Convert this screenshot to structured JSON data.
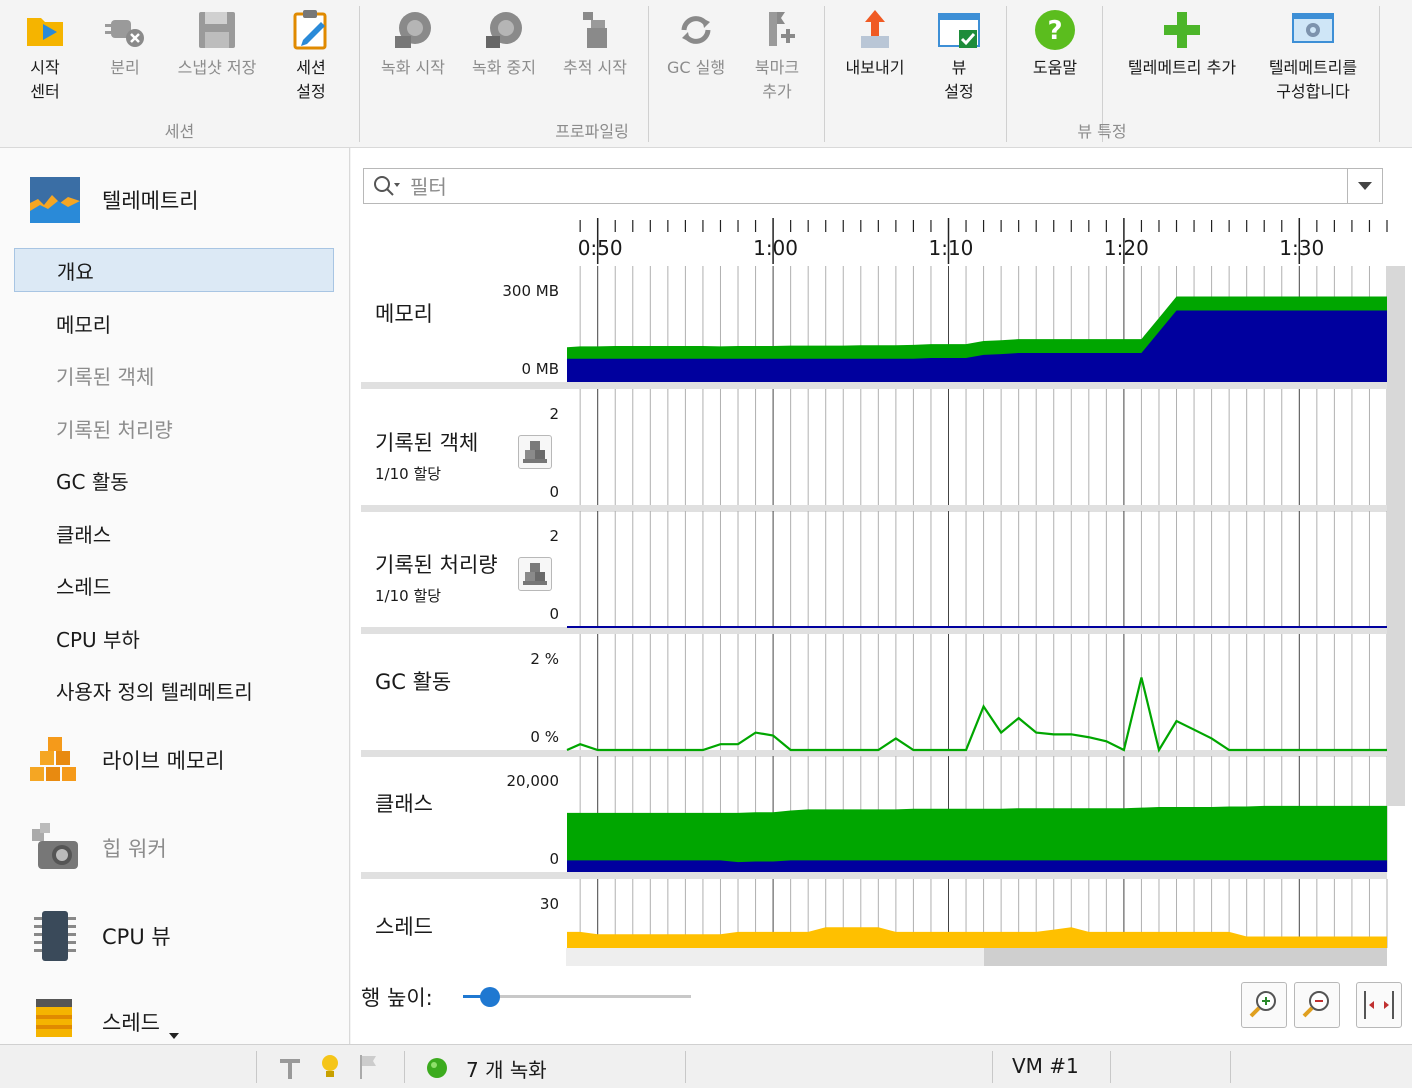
{
  "toolbar": {
    "buttons": [
      {
        "label": "시작\n센터",
        "icon": "start-center-icon",
        "enabled": true
      },
      {
        "label": "분리",
        "icon": "detach-icon",
        "enabled": false
      },
      {
        "label": "스냅샷 저장",
        "icon": "save-snapshot-icon",
        "enabled": false
      },
      {
        "label": "세션\n설정",
        "icon": "session-settings-icon",
        "enabled": true
      },
      {
        "label": "녹화 시작",
        "icon": "start-recording-icon",
        "enabled": false
      },
      {
        "label": "녹화 중지",
        "icon": "stop-recording-icon",
        "enabled": false
      },
      {
        "label": "추적 시작",
        "icon": "start-tracking-icon",
        "enabled": false
      },
      {
        "label": "GC 실행",
        "icon": "run-gc-icon",
        "enabled": false
      },
      {
        "label": "북마크\n추가",
        "icon": "add-bookmark-icon",
        "enabled": false
      },
      {
        "label": "내보내기",
        "icon": "export-icon",
        "enabled": true
      },
      {
        "label": "뷰\n설정",
        "icon": "view-settings-icon",
        "enabled": true
      },
      {
        "label": "도움말",
        "icon": "help-icon",
        "enabled": true
      },
      {
        "label": "텔레메트리 추가",
        "icon": "add-telemetry-icon",
        "enabled": true
      },
      {
        "label": "텔레메트리를\n구성합니다",
        "icon": "configure-telemetry-icon",
        "enabled": true
      }
    ],
    "groups": [
      "세션",
      "프로파일링",
      "뷰 특정"
    ]
  },
  "sidebar": {
    "telemetry_header": "텔레메트리",
    "items": [
      {
        "label": "개요",
        "selected": true,
        "enabled": true
      },
      {
        "label": "메모리",
        "selected": false,
        "enabled": true
      },
      {
        "label": "기록된 객체",
        "selected": false,
        "enabled": false
      },
      {
        "label": "기록된 처리량",
        "selected": false,
        "enabled": false
      },
      {
        "label": "GC 활동",
        "selected": false,
        "enabled": true
      },
      {
        "label": "클래스",
        "selected": false,
        "enabled": true
      },
      {
        "label": "스레드",
        "selected": false,
        "enabled": true
      },
      {
        "label": "CPU 부하",
        "selected": false,
        "enabled": true
      },
      {
        "label": "사용자 정의 텔레메트리",
        "selected": false,
        "enabled": true
      }
    ],
    "sections": [
      {
        "label": "라이브 메모리",
        "icon": "live-memory-icon",
        "enabled": true
      },
      {
        "label": "힙 워커",
        "icon": "heap-walker-icon",
        "enabled": false
      },
      {
        "label": "CPU 뷰",
        "icon": "cpu-views-icon",
        "enabled": true
      },
      {
        "label": "스레드",
        "icon": "threads-icon",
        "enabled": true
      }
    ]
  },
  "filter": {
    "placeholder": "필터",
    "value": ""
  },
  "time_ruler": {
    "ticks": [
      "0:50",
      "1:00",
      "1:10",
      "1:20",
      "1:30"
    ],
    "tick_values_sec": [
      50,
      60,
      70,
      80,
      90
    ]
  },
  "rows": [
    {
      "title": "메모리",
      "subtitle": "",
      "max_label": "300 MB",
      "min_label": "0 MB",
      "has_button": false
    },
    {
      "title": "기록된 객체",
      "subtitle": "1/10 할당",
      "max_label": "2",
      "min_label": "0",
      "has_button": true
    },
    {
      "title": "기록된 처리량",
      "subtitle": "1/10 할당",
      "max_label": "2",
      "min_label": "0",
      "has_button": true
    },
    {
      "title": "GC 활동",
      "subtitle": "",
      "max_label": "2 %",
      "min_label": "0 %",
      "has_button": false
    },
    {
      "title": "클래스",
      "subtitle": "",
      "max_label": "20,000",
      "min_label": "0",
      "has_button": false
    },
    {
      "title": "스레드",
      "subtitle": "",
      "max_label": "30",
      "min_label": "",
      "has_button": false
    }
  ],
  "chart_data": [
    {
      "type": "area",
      "name": "메모리",
      "ylim": [
        0,
        300
      ],
      "unit": "MB",
      "x": [
        48,
        49,
        50,
        51,
        52,
        53,
        54,
        55,
        56,
        57,
        58,
        59,
        60,
        61,
        62,
        63,
        64,
        65,
        66,
        67,
        68,
        69,
        70,
        71,
        72,
        73,
        74,
        75,
        76,
        77,
        78,
        79,
        80,
        81,
        82,
        83,
        84,
        85,
        86,
        87,
        88,
        89,
        90,
        91,
        92,
        93,
        94,
        95
      ],
      "series": [
        {
          "color": "#00a600",
          "values": [
            30,
            32,
            32,
            33,
            33,
            33,
            33,
            33,
            33,
            32,
            33,
            33,
            33,
            34,
            34,
            34,
            34,
            35,
            35,
            35,
            36,
            36,
            36,
            36,
            36,
            36,
            36,
            36,
            36,
            36,
            36,
            36,
            36,
            36,
            36,
            36,
            36,
            36,
            36,
            36,
            36,
            36,
            36,
            36,
            36,
            36,
            36,
            36
          ]
        },
        {
          "color": "#00009e",
          "values": [
            60,
            60,
            60,
            60,
            60,
            60,
            60,
            60,
            60,
            60,
            60,
            60,
            60,
            60,
            60,
            60,
            60,
            60,
            60,
            60,
            60,
            62,
            62,
            62,
            70,
            72,
            75,
            75,
            75,
            75,
            75,
            75,
            75,
            75,
            130,
            185,
            185,
            185,
            185,
            185,
            185,
            185,
            185,
            185,
            185,
            185,
            185,
            185
          ]
        }
      ]
    },
    {
      "type": "line",
      "name": "기록된 객체",
      "ylim": [
        0,
        2
      ],
      "series": []
    },
    {
      "type": "line",
      "name": "기록된 처리량",
      "ylim": [
        0,
        2
      ],
      "series": [
        {
          "color": "#00009e",
          "values": [
            0,
            0
          ]
        }
      ]
    },
    {
      "type": "line",
      "name": "GC 활동",
      "ylim": [
        0,
        2
      ],
      "unit": "%",
      "x": [
        48,
        49,
        50,
        51,
        52,
        53,
        54,
        55,
        56,
        57,
        58,
        59,
        60,
        61,
        62,
        63,
        64,
        65,
        66,
        67,
        68,
        69,
        70,
        71,
        72,
        73,
        74,
        75,
        76,
        77,
        78,
        79,
        80,
        81,
        82,
        83,
        84,
        85,
        86,
        87,
        88,
        89,
        90,
        91,
        92,
        93,
        94,
        95
      ],
      "series": [
        {
          "color": "#00a600",
          "values": [
            0,
            0.1,
            0,
            0,
            0,
            0,
            0,
            0,
            0,
            0.1,
            0.1,
            0.3,
            0.25,
            0,
            0,
            0,
            0,
            0,
            0,
            0.2,
            0,
            0,
            0,
            0,
            0.75,
            0.3,
            0.55,
            0.3,
            0.27,
            0.27,
            0.22,
            0.15,
            0,
            1.25,
            0,
            0.5,
            0.35,
            0.2,
            0,
            0,
            0,
            0,
            0,
            0,
            0,
            0,
            0,
            0
          ]
        }
      ]
    },
    {
      "type": "area",
      "name": "클래스",
      "ylim": [
        0,
        20000
      ],
      "x": [
        48,
        49,
        50,
        51,
        52,
        53,
        54,
        55,
        56,
        57,
        58,
        59,
        60,
        61,
        62,
        63,
        64,
        65,
        66,
        67,
        68,
        69,
        70,
        71,
        72,
        73,
        74,
        75,
        76,
        77,
        78,
        79,
        80,
        81,
        82,
        83,
        84,
        85,
        86,
        87,
        88,
        89,
        90,
        91,
        92,
        93,
        94,
        95
      ],
      "series": [
        {
          "color": "#00a600",
          "values": [
            8200,
            8200,
            8200,
            8200,
            8200,
            8200,
            8200,
            8200,
            8200,
            8200,
            8500,
            8500,
            8500,
            8600,
            8800,
            8800,
            8800,
            8800,
            8800,
            8800,
            8900,
            8900,
            8900,
            8900,
            8900,
            8900,
            9000,
            9000,
            9000,
            9000,
            9000,
            9000,
            9000,
            9100,
            9200,
            9200,
            9200,
            9200,
            9300,
            9300,
            9400,
            9400,
            9400,
            9400,
            9400,
            9400,
            9400,
            9400
          ]
        },
        {
          "color": "#00009e",
          "values": [
            2000,
            2000,
            2000,
            2000,
            2000,
            2000,
            2000,
            2000,
            2000,
            2000,
            1700,
            1800,
            1800,
            2000,
            2000,
            2000,
            2000,
            2000,
            2000,
            2000,
            2000,
            2000,
            2000,
            2000,
            2000,
            2000,
            2000,
            2000,
            2000,
            2000,
            2000,
            2000,
            2000,
            2000,
            2000,
            2000,
            2000,
            2000,
            2000,
            2000,
            2000,
            2000,
            2000,
            2000,
            2000,
            2000,
            2000,
            2000
          ]
        }
      ]
    },
    {
      "type": "area",
      "name": "스레드",
      "ylim": [
        0,
        30
      ],
      "x": [
        48,
        49,
        50,
        51,
        52,
        53,
        54,
        55,
        56,
        57,
        58,
        59,
        60,
        61,
        62,
        63,
        64,
        65,
        66,
        67,
        68,
        69,
        70,
        71,
        72,
        73,
        74,
        75,
        76,
        77,
        78,
        79,
        80,
        81,
        82,
        83,
        84,
        85,
        86,
        87,
        88,
        89,
        90,
        91,
        92,
        93,
        94,
        95
      ],
      "series": [
        {
          "color": "#ffc000",
          "values": [
            7,
            7,
            6,
            6,
            6,
            6,
            6,
            6,
            6,
            6,
            7,
            7,
            7,
            7,
            7,
            9,
            9,
            9,
            9,
            7,
            7,
            7,
            7,
            7,
            7,
            7,
            7,
            7,
            8,
            9,
            7,
            7,
            7,
            7,
            7,
            7,
            7,
            7,
            7,
            5,
            5,
            5,
            5,
            5,
            5,
            5,
            5,
            5
          ]
        }
      ]
    }
  ],
  "bottom": {
    "row_height_label": "행 높이:",
    "row_height_value": 0.12
  },
  "statusbar": {
    "recordings": "7 개 녹화",
    "vm": "VM #1"
  }
}
